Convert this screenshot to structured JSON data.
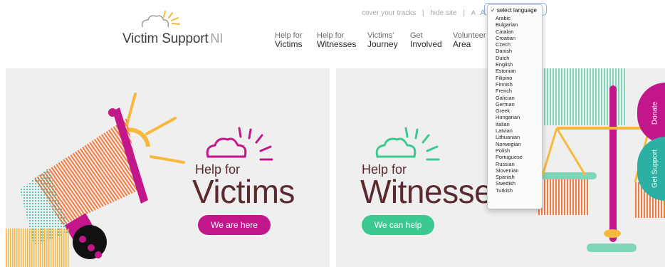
{
  "brand": {
    "name": "Victim Support",
    "suffix": "NI"
  },
  "toplinks": {
    "cover": "cover your tracks",
    "hide": "hide site",
    "sep": "|",
    "font_sizes": [
      "A",
      "A",
      "A"
    ]
  },
  "nav": [
    {
      "line1": "Help for",
      "line2": "Victims"
    },
    {
      "line1": "Help for",
      "line2": "Witnesses"
    },
    {
      "line1": "Victims'",
      "line2": "Journey"
    },
    {
      "line1": "Get",
      "line2": "Involved"
    },
    {
      "line1": "Volunteer",
      "line2": "Area"
    }
  ],
  "panels": {
    "victims": {
      "help_for": "Help for",
      "title": "Victims",
      "cta": "We are here"
    },
    "witnesses": {
      "help_for": "Help for",
      "title": "Witnesses",
      "cta": "We can help"
    }
  },
  "side_tabs": {
    "donate": "Donate",
    "support": "Get Support"
  },
  "language": {
    "selected": "✓ select language",
    "options": [
      "Arabic",
      "Bulgarian",
      "Catalan",
      "Croatian",
      "Czech",
      "Danish",
      "Dutch",
      "English",
      "Estonian",
      "Filipino",
      "Finnish",
      "French",
      "Galician",
      "German",
      "Greek",
      "Hungarian",
      "Italian",
      "Latvian",
      "Lithuanian",
      "Norwegian",
      "Polish",
      "Portuguese",
      "Russian",
      "Slovenian",
      "Spanish",
      "Swedish",
      "Turkish"
    ]
  },
  "colors": {
    "magenta": "#c2168b",
    "green": "#3cc98f",
    "teal": "#2bb0a3",
    "orange": "#f47b3e",
    "yellow": "#f6b93b",
    "maroon": "#5a2a2f"
  }
}
